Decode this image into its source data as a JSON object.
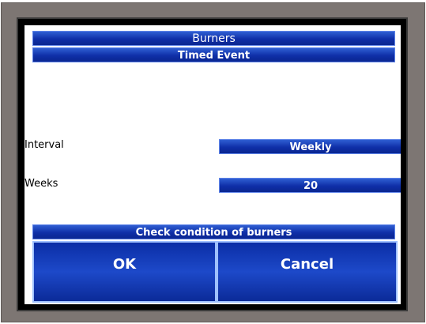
{
  "screen": {
    "title": "Burners",
    "subtitle": "Timed Event"
  },
  "fields": {
    "interval": {
      "label": "Interval",
      "value": "Weekly"
    },
    "weeks": {
      "label": "Weeks",
      "value": "20"
    }
  },
  "message": "Check condition of burners",
  "buttons": {
    "ok": "OK",
    "cancel": "Cancel"
  },
  "colors": {
    "bezel": "#7d7673",
    "bar_blue": "#0f2fa8",
    "button_border": "#9fc1ff"
  }
}
